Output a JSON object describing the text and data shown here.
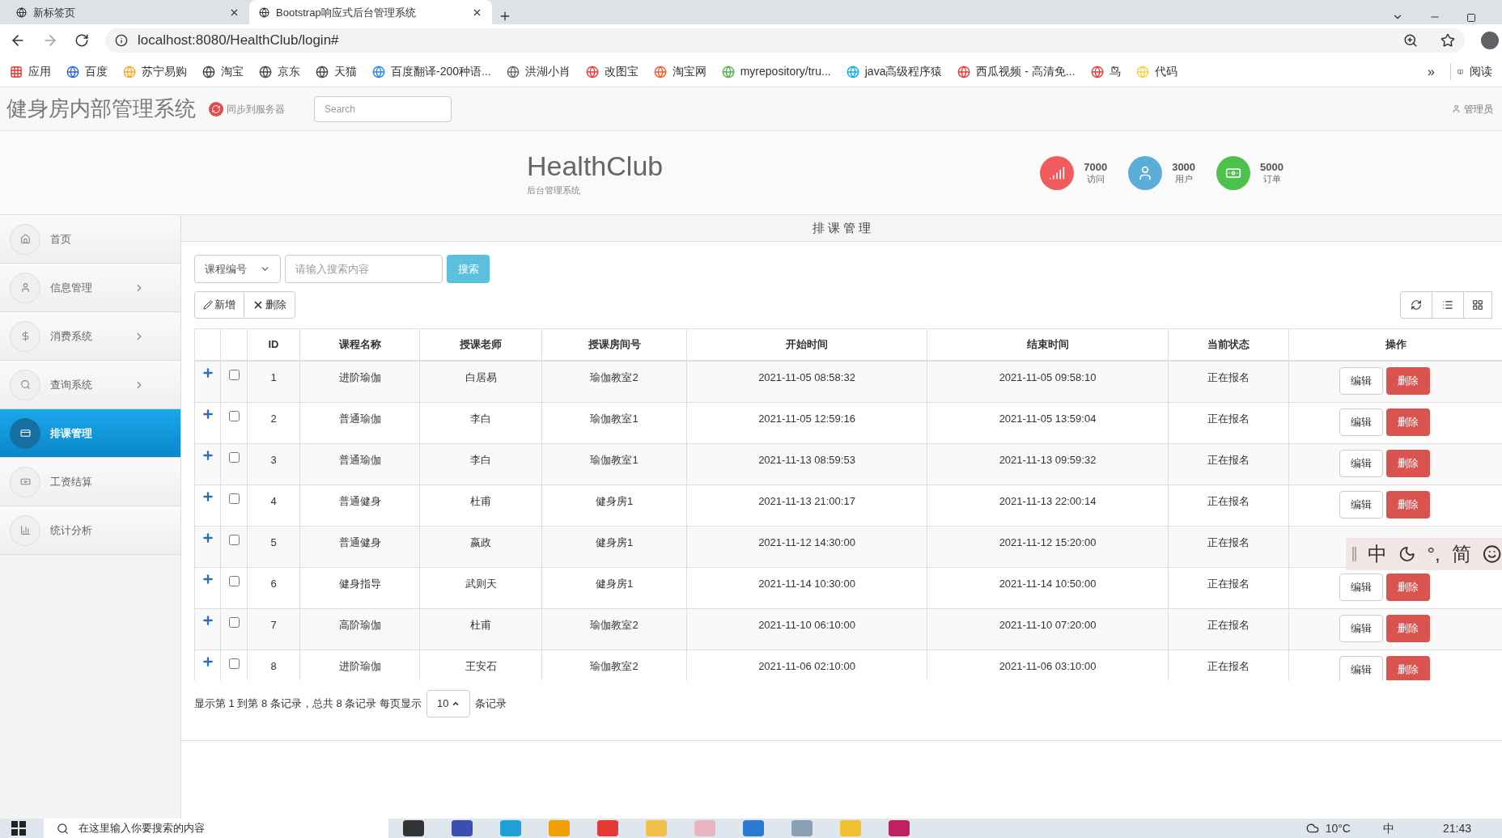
{
  "browser": {
    "tabs": [
      {
        "title": "新标签页",
        "selected": false
      },
      {
        "title": "Bootstrap响应式后台管理系统",
        "selected": true
      }
    ],
    "address": "localhost:8080/HealthClub/login#",
    "bookmarks": [
      {
        "label": "应用"
      },
      {
        "label": "百度"
      },
      {
        "label": "苏宁易购"
      },
      {
        "label": "淘宝"
      },
      {
        "label": "京东"
      },
      {
        "label": "天猫"
      },
      {
        "label": "百度翻译-200种语..."
      },
      {
        "label": "洪湖小肖"
      },
      {
        "label": "改图宝"
      },
      {
        "label": "淘宝网"
      },
      {
        "label": "myrepository/tru..."
      },
      {
        "label": "java高级程序猿"
      },
      {
        "label": "西瓜视频 - 高清免..."
      },
      {
        "label": "鸟"
      },
      {
        "label": "代码"
      }
    ],
    "more": "»",
    "reading": "阅读"
  },
  "navbar": {
    "title": "健身房内部管理系统",
    "sync_button": "同步到服务器",
    "search_placeholder": "Search",
    "user": "管理员"
  },
  "header": {
    "brand": "HealthClub",
    "subtitle": "后台管理系统",
    "stats": [
      {
        "kind": "visits",
        "value": "7000",
        "label": "访问",
        "color": "#f15b5b"
      },
      {
        "kind": "users",
        "value": "3000",
        "label": "用户",
        "color": "#5aaed8"
      },
      {
        "kind": "orders",
        "value": "5000",
        "label": "订单",
        "color": "#4cc24c"
      }
    ]
  },
  "sidebar": {
    "items": [
      {
        "label": "首页",
        "selected": false,
        "has_children": false
      },
      {
        "label": "信息管理",
        "selected": false,
        "has_children": true
      },
      {
        "label": "消费系统",
        "selected": false,
        "has_children": true
      },
      {
        "label": "查询系统",
        "selected": false,
        "has_children": true
      },
      {
        "label": "排课管理",
        "selected": true,
        "has_children": false
      },
      {
        "label": "工资结算",
        "selected": false,
        "has_children": false
      },
      {
        "label": "统计分析",
        "selected": false,
        "has_children": false
      }
    ]
  },
  "panel": {
    "title": "排 课 管 理",
    "search": {
      "select": "课程编号",
      "placeholder": "请输入搜索内容",
      "button": "搜索"
    },
    "toolbar": [
      {
        "kind": "add",
        "label": "新增"
      },
      {
        "kind": "delete",
        "label": "删除"
      }
    ],
    "table": {
      "columns": [
        "ID",
        "课程名称",
        "授课老师",
        "授课房间号",
        "开始时间",
        "结束时间",
        "当前状态",
        "操作"
      ],
      "rows": [
        {
          "checked": false,
          "cells": [
            "1",
            "进阶瑜伽",
            "白居易",
            "瑜伽教室2",
            "2021-11-05 08:58:32",
            "2021-11-05 09:58:10",
            "正在报名"
          ],
          "actions": [
            "编辑",
            "删除"
          ]
        },
        {
          "checked": false,
          "cells": [
            "2",
            "普通瑜伽",
            "李白",
            "瑜伽教室1",
            "2021-11-05 12:59:16",
            "2021-11-05 13:59:04",
            "正在报名"
          ],
          "actions": [
            "编辑",
            "删除"
          ]
        },
        {
          "checked": false,
          "cells": [
            "3",
            "普通瑜伽",
            "李白",
            "瑜伽教室1",
            "2021-11-13 08:59:53",
            "2021-11-13 09:59:32",
            "正在报名"
          ],
          "actions": [
            "编辑",
            "删除"
          ]
        },
        {
          "checked": false,
          "cells": [
            "4",
            "普通健身",
            "杜甫",
            "健身房1",
            "2021-11-13 21:00:17",
            "2021-11-13 22:00:14",
            "正在报名"
          ],
          "actions": [
            "编辑",
            "删除"
          ]
        },
        {
          "checked": false,
          "cells": [
            "5",
            "普通健身",
            "嬴政",
            "健身房1",
            "2021-11-12 14:30:00",
            "2021-11-12 15:20:00",
            "正在报名"
          ]
        },
        {
          "checked": false,
          "cells": [
            "6",
            "健身指导",
            "武则天",
            "健身房1",
            "2021-11-14 10:30:00",
            "2021-11-14 10:50:00",
            "正在报名"
          ],
          "actions": [
            "编辑",
            "删除"
          ]
        },
        {
          "checked": false,
          "cells": [
            "7",
            "高阶瑜伽",
            "杜甫",
            "瑜伽教室2",
            "2021-11-10 06:10:00",
            "2021-11-10 07:20:00",
            "正在报名"
          ],
          "actions": [
            "编辑",
            "删除"
          ]
        },
        {
          "checked": false,
          "cells": [
            "8",
            "进阶瑜伽",
            "王安石",
            "瑜伽教室2",
            "2021-11-06 02:10:00",
            "2021-11-06 03:10:00",
            "正在报名"
          ],
          "actions": [
            "编辑",
            "删除"
          ]
        }
      ]
    },
    "pagination": {
      "summary": "显示第 1 到第 8 条记录，总共 8 条记录 每页显示",
      "page_size": "10",
      "suffix": "条记录"
    }
  },
  "ime": {
    "items": [
      "中",
      "°,",
      "简"
    ]
  },
  "taskbar": {
    "search_placeholder": "在这里输入你要搜索的内容",
    "weather": "10°C",
    "ime": "中",
    "time": "21:43"
  }
}
